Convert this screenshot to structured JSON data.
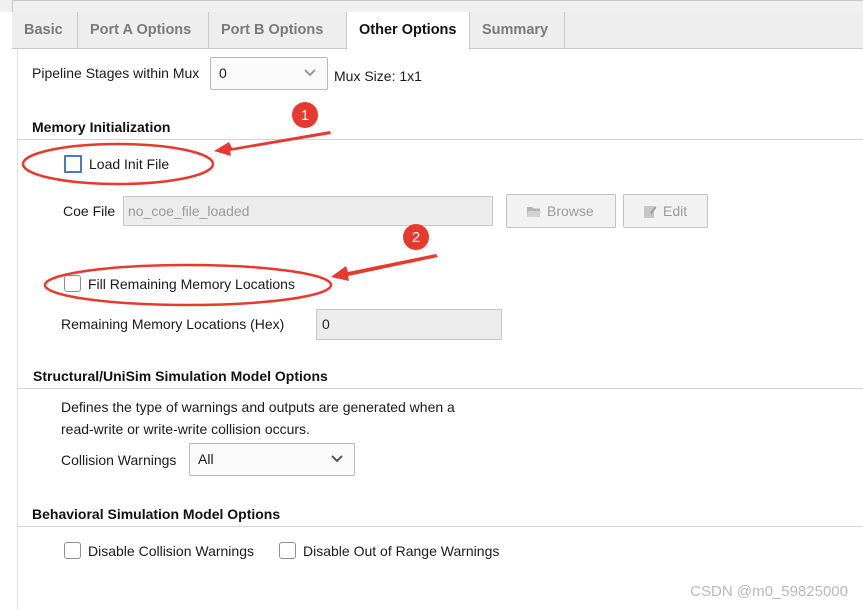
{
  "tabs": [
    {
      "label": "Basic"
    },
    {
      "label": "Port A Options"
    },
    {
      "label": "Port B Options"
    },
    {
      "label": "Other Options"
    },
    {
      "label": "Summary"
    }
  ],
  "active_tab": "Other Options",
  "pipeline": {
    "label": "Pipeline Stages within Mux",
    "value": "0",
    "mux_size": "Mux Size: 1x1"
  },
  "memory_init": {
    "title": "Memory Initialization",
    "load_init_label": "Load Init File",
    "load_init_checked": false,
    "coe_label": "Coe File",
    "coe_value": "no_coe_file_loaded",
    "browse_label": "Browse",
    "edit_label": "Edit",
    "fill_label": "Fill Remaining Memory Locations",
    "fill_checked": false,
    "remaining_label": "Remaining Memory Locations (Hex)",
    "remaining_value": "0"
  },
  "structural": {
    "title": "Structural/UniSim Simulation Model Options",
    "desc_line1": "Defines the type of warnings and outputs are generated when a",
    "desc_line2": "read-write or write-write collision occurs.",
    "collision_label": "Collision Warnings",
    "collision_value": "All"
  },
  "behavioral": {
    "title": "Behavioral Simulation Model Options",
    "disable_collision_label": "Disable Collision Warnings",
    "disable_collision_checked": false,
    "disable_range_label": "Disable Out of Range Warnings",
    "disable_range_checked": false
  },
  "annotations": {
    "marker1": "1",
    "marker2": "2",
    "color": "#e8392f"
  },
  "watermark": "CSDN @m0_59825000",
  "colors": {
    "tab_active_bg": "#ffffff",
    "tab_bg": "#eeeeee",
    "checkbox_focus": "#4a77c3",
    "annotation": "#e8392f"
  }
}
